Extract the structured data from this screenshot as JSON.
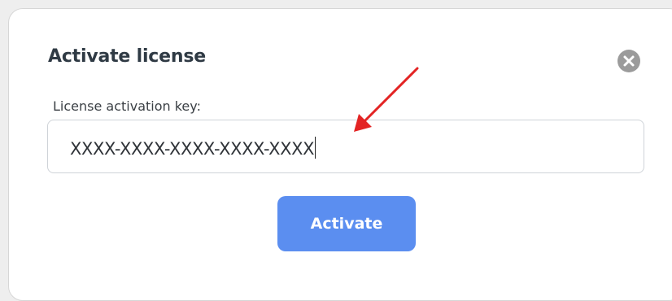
{
  "dialog": {
    "title": "Activate license",
    "field_label": "License activation key:",
    "input_value": "XXXX-XXXX-XXXX-XXXX-XXXX",
    "activate_label": "Activate"
  },
  "colors": {
    "primary_button": "#5b8ef0",
    "annotation_arrow": "#e32424",
    "close_icon_bg": "#9b9b9b"
  },
  "icons": {
    "close": "close-icon",
    "annotation": "red-arrow-annotation"
  }
}
